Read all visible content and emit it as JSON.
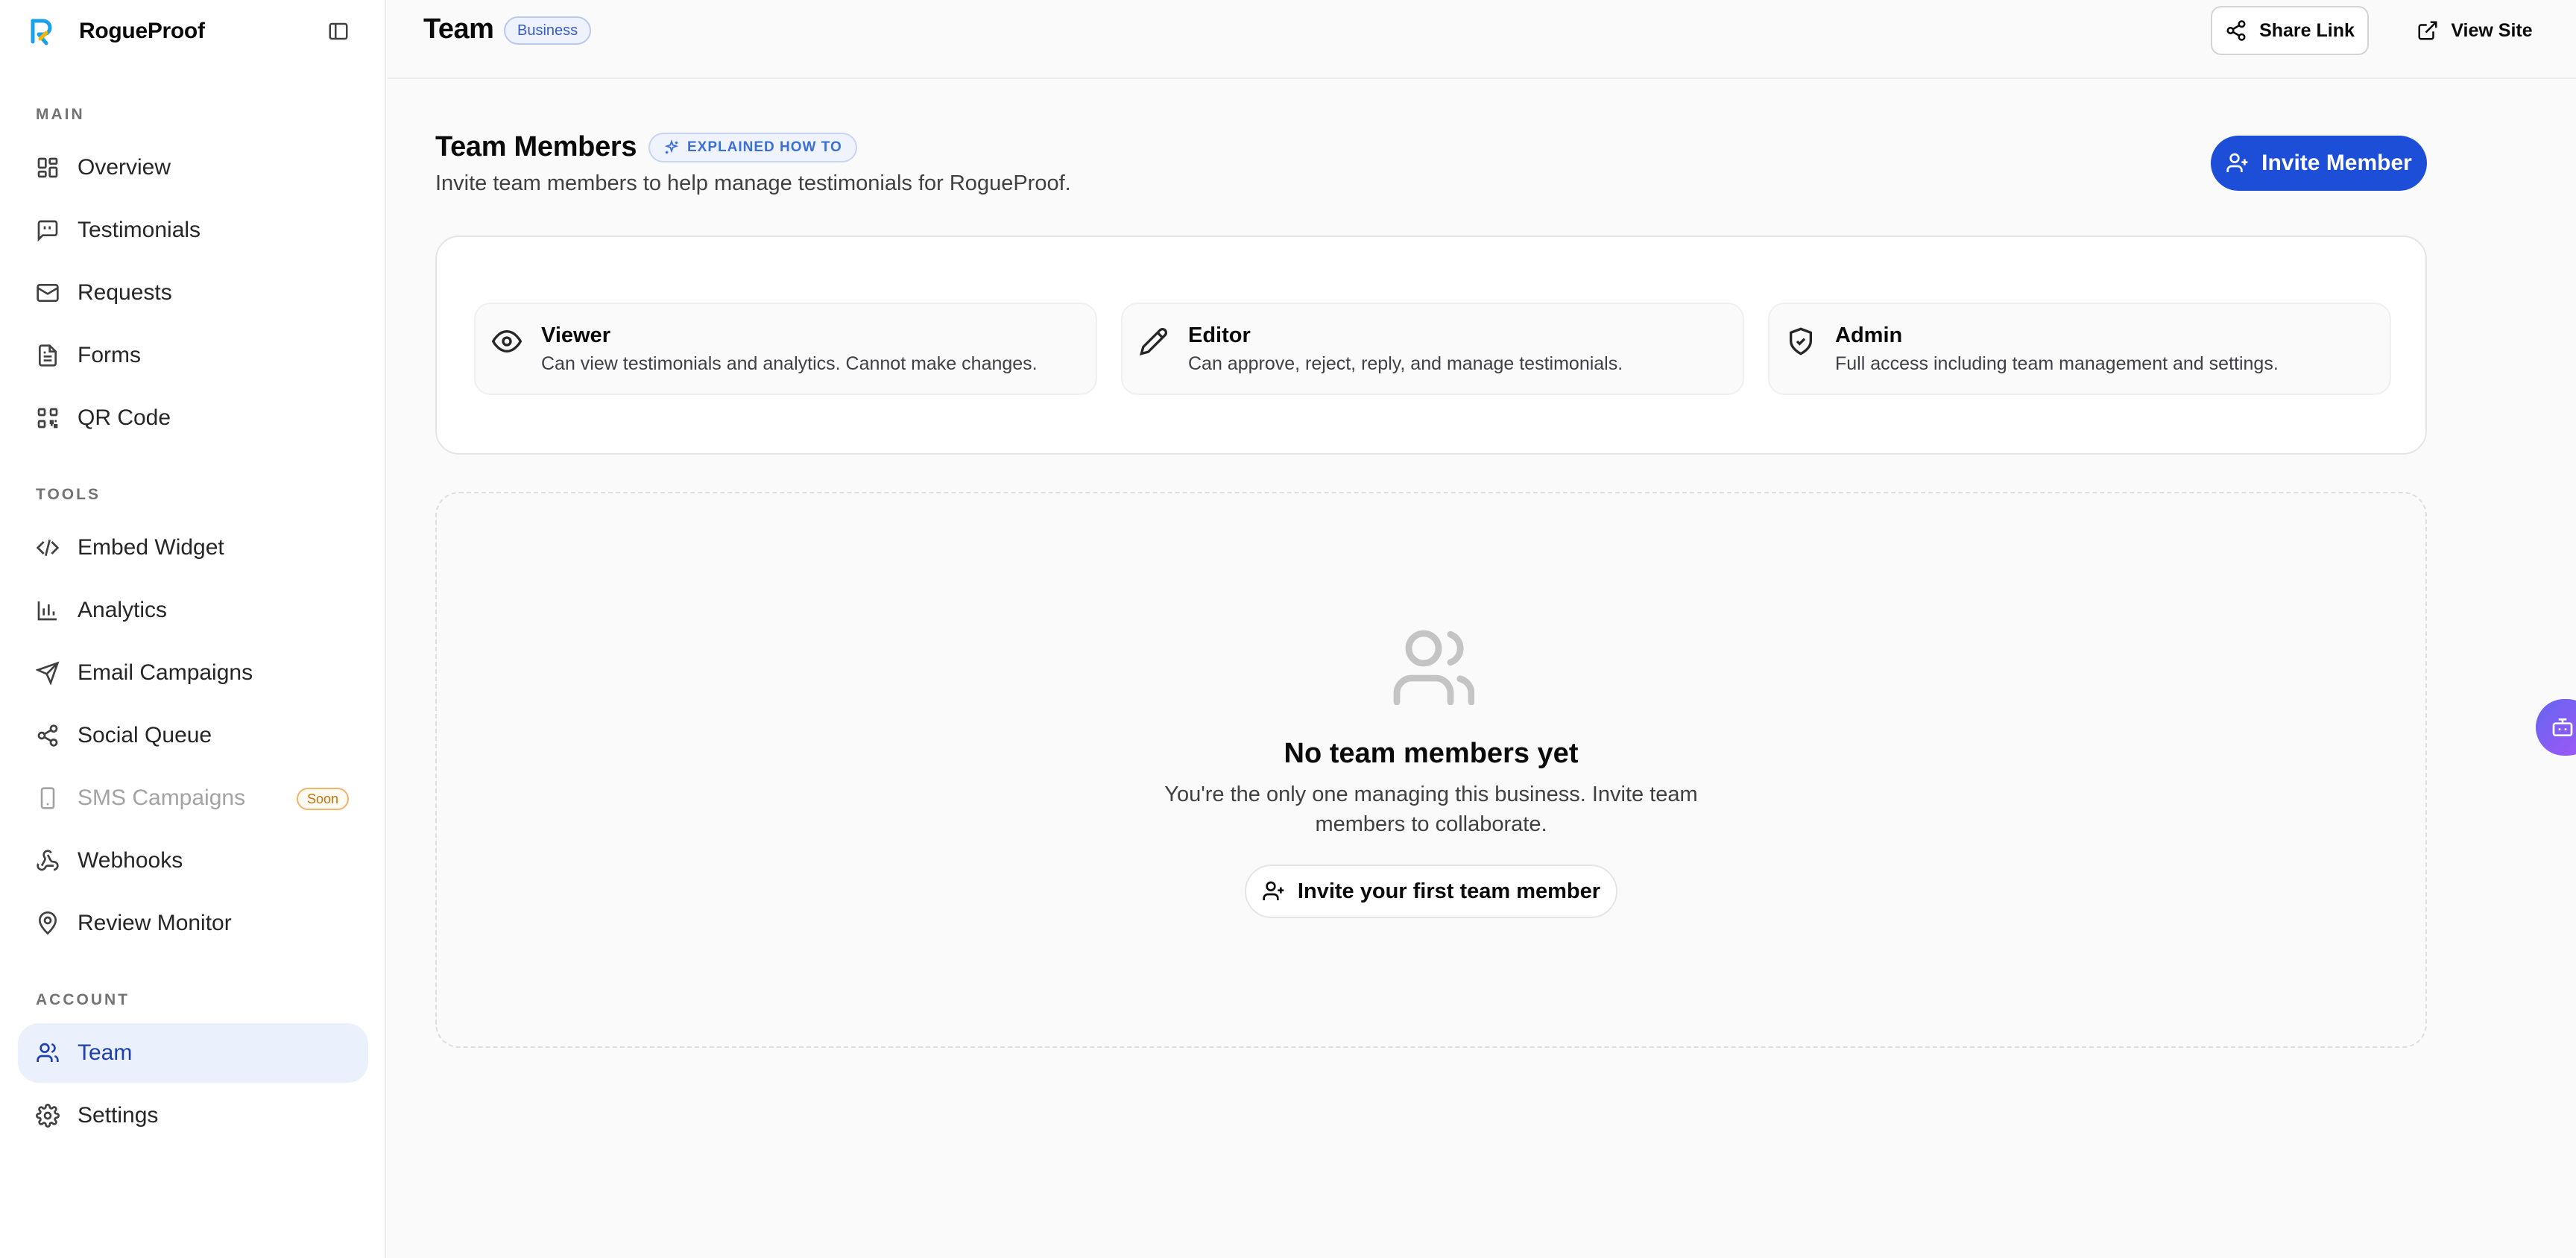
{
  "brand": {
    "name": "RogueProof"
  },
  "sidebar": {
    "sections": {
      "main": "MAIN",
      "tools": "TOOLS",
      "account": "ACCOUNT"
    },
    "main_items": [
      {
        "label": "Overview",
        "icon": "grid-icon"
      },
      {
        "label": "Testimonials",
        "icon": "message-quote-icon"
      },
      {
        "label": "Requests",
        "icon": "mail-icon"
      },
      {
        "label": "Forms",
        "icon": "document-icon"
      },
      {
        "label": "QR Code",
        "icon": "qr-code-icon"
      }
    ],
    "tool_items": [
      {
        "label": "Embed Widget",
        "icon": "code-icon"
      },
      {
        "label": "Analytics",
        "icon": "bar-chart-icon"
      },
      {
        "label": "Email Campaigns",
        "icon": "send-icon"
      },
      {
        "label": "Social Queue",
        "icon": "share-icon"
      },
      {
        "label": "SMS Campaigns",
        "icon": "phone-icon",
        "badge": "Soon"
      },
      {
        "label": "Webhooks",
        "icon": "webhook-icon"
      },
      {
        "label": "Review Monitor",
        "icon": "map-pin-icon"
      }
    ],
    "account_items": [
      {
        "label": "Team",
        "icon": "users-icon",
        "active": true
      },
      {
        "label": "Settings",
        "icon": "gear-icon"
      }
    ]
  },
  "header": {
    "title": "Team",
    "badge": "Business",
    "share_label": "Share Link",
    "view_label": "View Site"
  },
  "main": {
    "title": "Team Members",
    "explained_badge": "EXPLAINED HOW TO",
    "subtitle": "Invite team members to help manage testimonials for RogueProof.",
    "invite_label": "Invite Member",
    "roles": [
      {
        "name": "Viewer",
        "desc": "Can view testimonials and analytics. Cannot make changes.",
        "icon": "eye-icon"
      },
      {
        "name": "Editor",
        "desc": "Can approve, reject, reply, and manage testimonials.",
        "icon": "pencil-icon"
      },
      {
        "name": "Admin",
        "desc": "Full access including team management and settings.",
        "icon": "shield-check-icon"
      }
    ],
    "empty": {
      "title": "No team members yet",
      "desc": "You're the only one managing this business. Invite team members to collaborate.",
      "button": "Invite your first team member"
    }
  },
  "colors": {
    "accent": "#1d4ed8",
    "active_bg": "#eaf0fc",
    "soon": "#c2720c"
  }
}
